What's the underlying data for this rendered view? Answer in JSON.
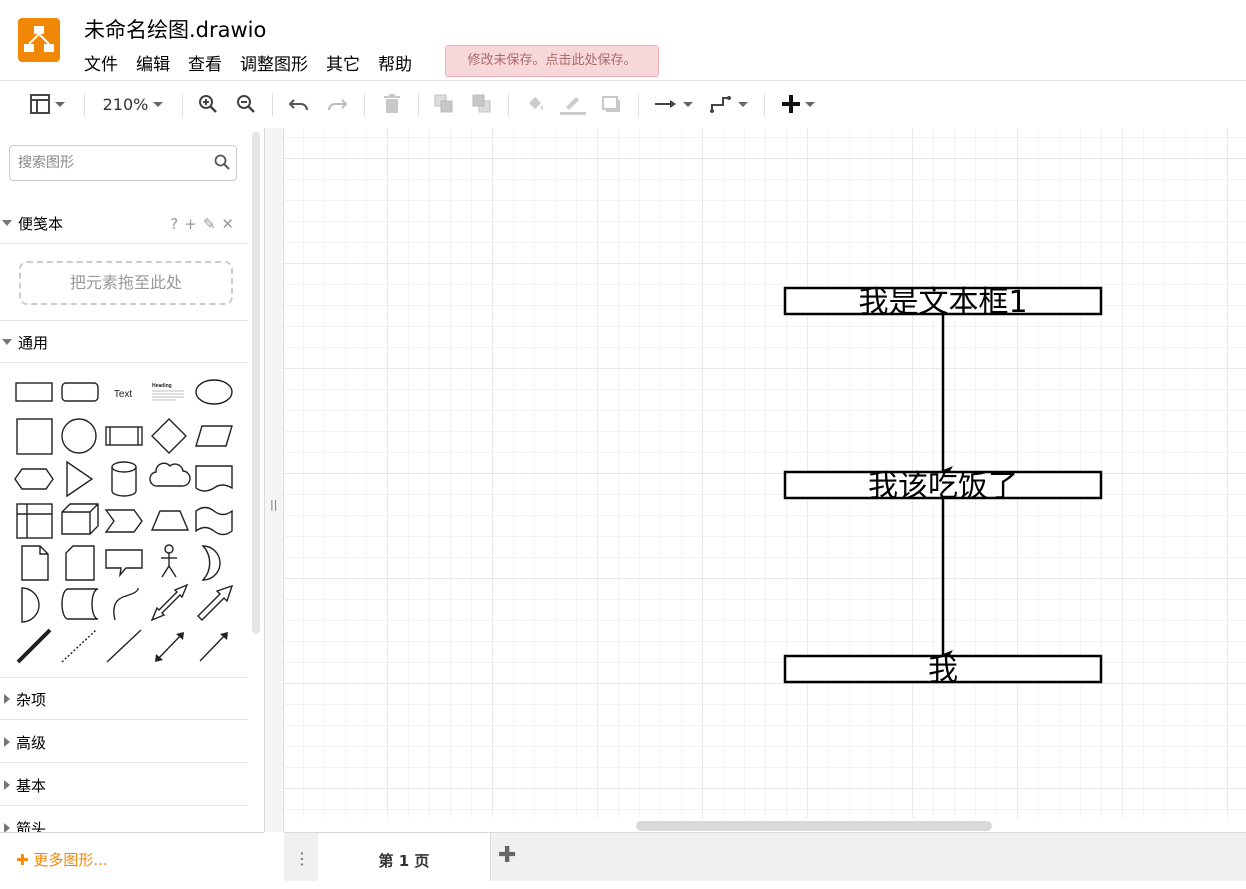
{
  "window": {
    "title": "未命名绘图.drawio",
    "save_notice": "修改未保存。点击此处保存。"
  },
  "menu": [
    "文件",
    "编辑",
    "查看",
    "调整图形",
    "其它",
    "帮助"
  ],
  "toolbar": {
    "zoom": "210%",
    "icons": [
      "format-panel-icon",
      "zoom-in-icon",
      "zoom-out-icon",
      "undo-icon",
      "redo-icon",
      "delete-icon",
      "to-front-icon",
      "to-back-icon",
      "fill-color-icon",
      "line-color-icon",
      "shadow-icon",
      "connection-icon",
      "waypoints-icon",
      "insert-icon"
    ]
  },
  "sidebar": {
    "search_placeholder": "搜索图形",
    "scratchpad": {
      "label": "便笺本",
      "tools": [
        "?",
        "+",
        "✎",
        "✕"
      ],
      "drop_hint": "把元素拖至此处"
    },
    "general_label": "通用",
    "general_shapes": {
      "text_shape": "Text",
      "heading_shape": "Heading"
    },
    "collapsed_sections": [
      "杂项",
      "高级",
      "基本",
      "箭头"
    ],
    "more_shapes": "✚ 更多图形..."
  },
  "diagram": {
    "nodes": [
      {
        "id": "n1",
        "label": "我是文本框1"
      },
      {
        "id": "n2",
        "label": "我该吃饭了"
      },
      {
        "id": "n3",
        "label": "我"
      }
    ],
    "edges": [
      {
        "from": "n1",
        "to": "n2"
      },
      {
        "from": "n2",
        "to": "n3"
      }
    ],
    "stroke_color": "#000000"
  },
  "pages": {
    "current": "第 1 页"
  },
  "colors": {
    "brand": "#f08705",
    "notice_bg": "#f8d7da",
    "notice_text": "#a86b6b"
  }
}
